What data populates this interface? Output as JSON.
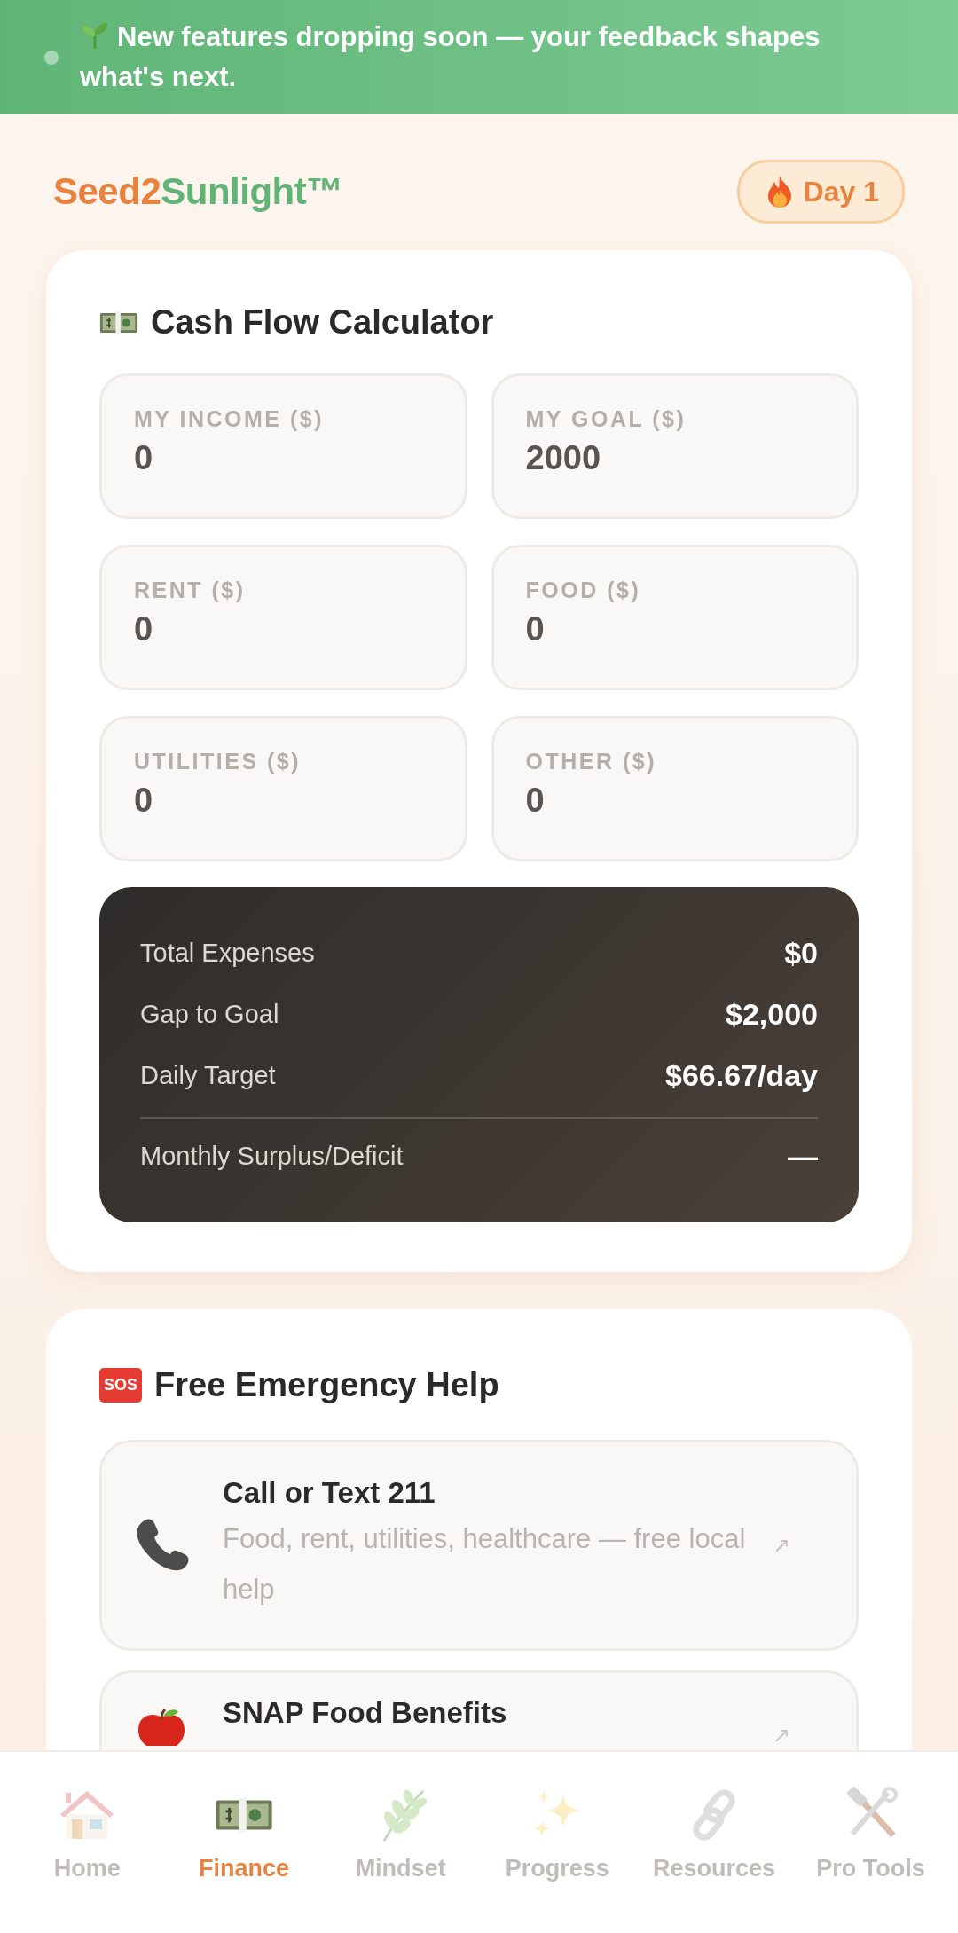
{
  "banner": {
    "text": "New features dropping soon — your feedback shapes what's next."
  },
  "header": {
    "brand": [
      {
        "text": "Seed2",
        "color": "#e8823f"
      },
      {
        "text": "Sunlight™",
        "color": "#5fb476"
      }
    ],
    "streak": "Day 1"
  },
  "calculator": {
    "title": "Cash Flow Calculator",
    "fields": [
      {
        "label": "MY INCOME ($)",
        "value": "0"
      },
      {
        "label": "MY GOAL ($)",
        "value": "2000"
      },
      {
        "label": "RENT ($)",
        "value": "0"
      },
      {
        "label": "FOOD ($)",
        "value": "0"
      },
      {
        "label": "UTILITIES ($)",
        "value": "0"
      },
      {
        "label": "OTHER ($)",
        "value": "0"
      }
    ],
    "summary": [
      {
        "label": "Total Expenses",
        "value": "$0"
      },
      {
        "label": "Gap to Goal",
        "value": "$2,000"
      },
      {
        "label": "Daily Target",
        "value": "$66.67/day"
      }
    ],
    "footer": {
      "label": "Monthly Surplus/Deficit",
      "value": "—"
    }
  },
  "help": {
    "badge": "SOS",
    "title": "Free Emergency Help",
    "items": [
      {
        "title": "Call or Text 211",
        "description": "Food, rent, utilities, healthcare — free local help",
        "arrow": "↗"
      },
      {
        "title": "SNAP Food Benefits",
        "arrow": "↗"
      }
    ]
  },
  "nav": [
    {
      "label": "Home",
      "selected": false
    },
    {
      "label": "Finance",
      "selected": true
    },
    {
      "label": "Mindset",
      "selected": false
    },
    {
      "label": "Progress",
      "selected": false
    },
    {
      "label": "Resources",
      "selected": false
    },
    {
      "label": "Pro Tools",
      "selected": false
    }
  ]
}
